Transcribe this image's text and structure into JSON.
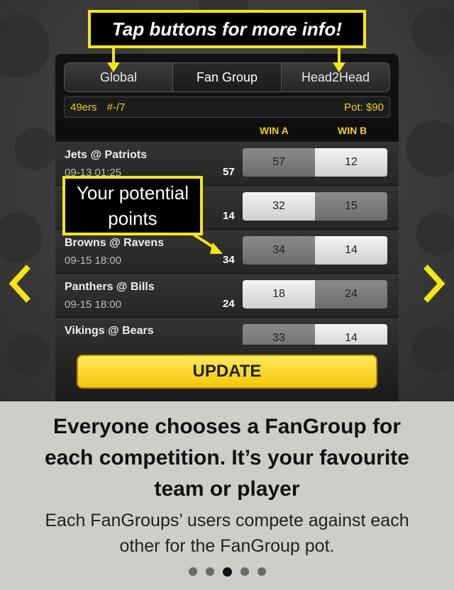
{
  "callouts": {
    "top": "Tap buttons for more info!",
    "mid_line1": "Your potential",
    "mid_line2": "points"
  },
  "tabs": [
    {
      "label": "Global",
      "active": false
    },
    {
      "label": "Fan Group",
      "active": true
    },
    {
      "label": "Head2Head",
      "active": false
    }
  ],
  "pot_bar": {
    "team": "49ers",
    "rank": "#-/7",
    "pot": "Pot: $90"
  },
  "columns": {
    "win_a": "WIN A",
    "win_b": "WIN B"
  },
  "matches": [
    {
      "match": "Jets @ Patriots",
      "time": "09-13 01:25",
      "points": "57",
      "win_a": "57",
      "win_b": "12",
      "selected": "b"
    },
    {
      "match": "",
      "time": "",
      "points": "14",
      "win_a": "32",
      "win_b": "15",
      "selected": "a"
    },
    {
      "match": "Browns @ Ravens",
      "time": "09-15 18:00",
      "points": "34",
      "win_a": "34",
      "win_b": "14",
      "selected": "b"
    },
    {
      "match": "Panthers @ Bills",
      "time": "09-15 18:00",
      "points": "24",
      "win_a": "18",
      "win_b": "24",
      "selected": "a"
    },
    {
      "match": "Vikings @ Bears",
      "time": "",
      "points": "",
      "win_a": "33",
      "win_b": "14",
      "selected": "b"
    }
  ],
  "update_label": "UPDATE",
  "info": {
    "heading_line1": "Everyone chooses a FanGroup for",
    "heading_line2": "each competition. It’s your favourite",
    "heading_line3": "team or player",
    "desc_line1": "Each FanGroups’ users compete against each",
    "desc_line2": "other for the FanGroup pot."
  },
  "pagination": {
    "total": 5,
    "active_index": 2
  },
  "colors": {
    "accent": "#f2e51a",
    "pot_text": "#f2cf1a",
    "panel": "#cfcdc8"
  }
}
